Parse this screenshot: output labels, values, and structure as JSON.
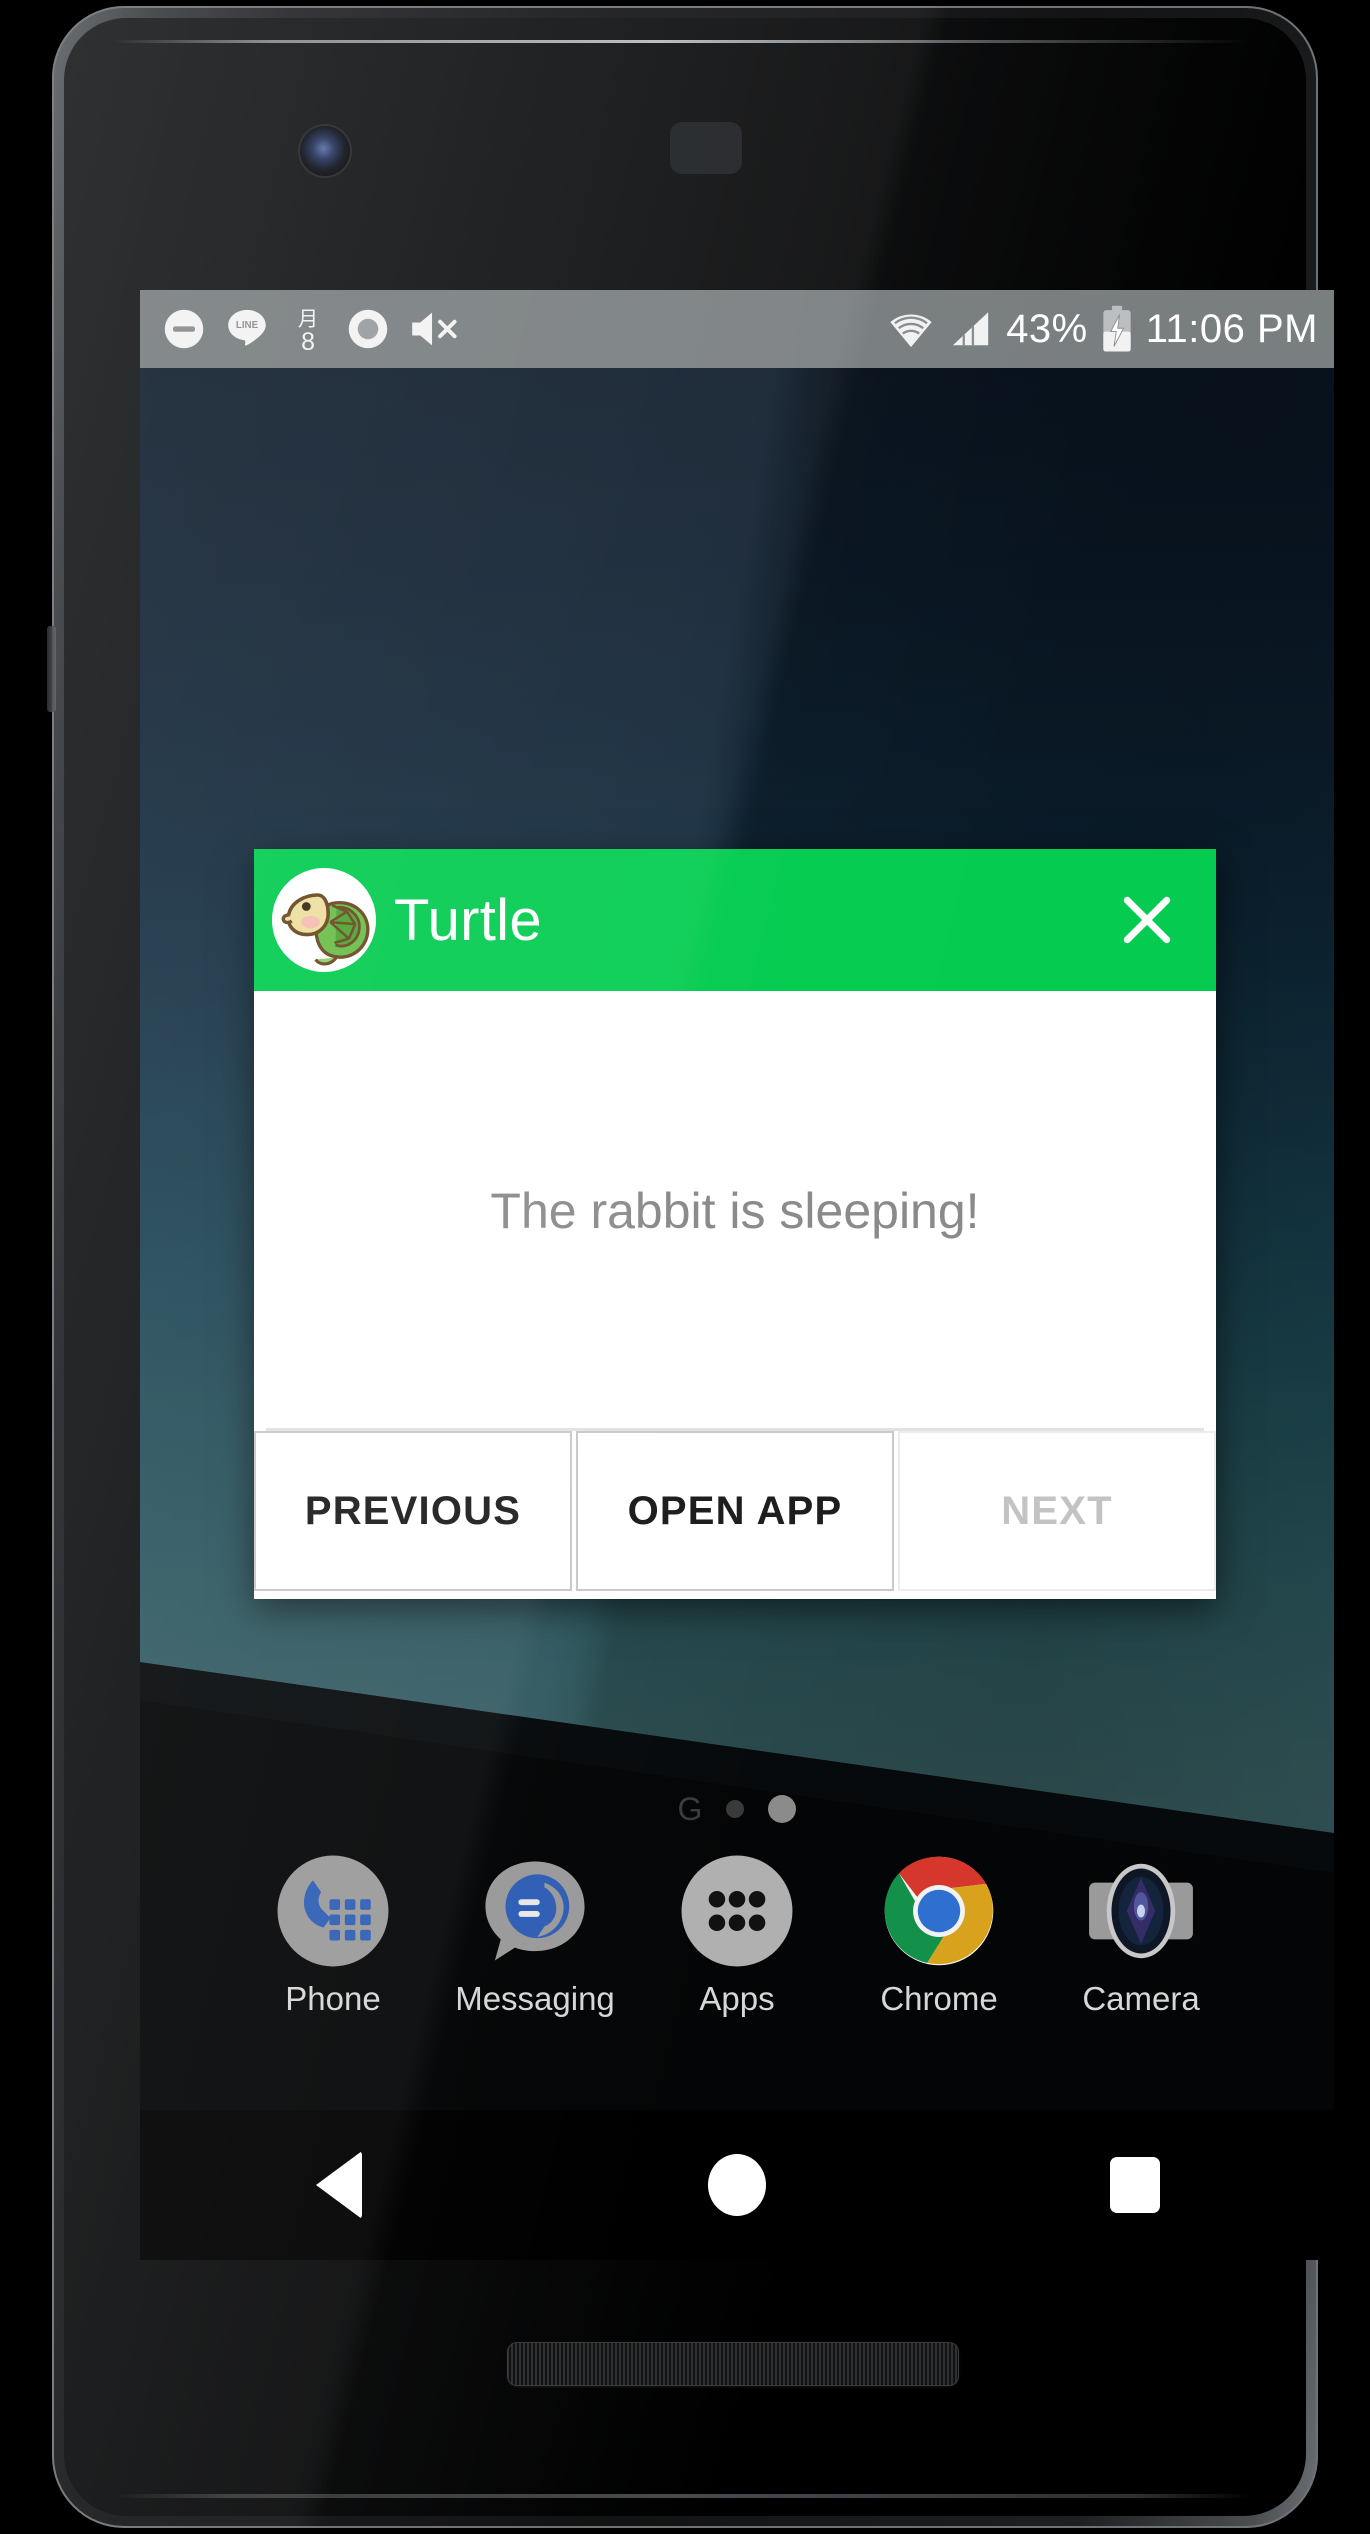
{
  "status_bar": {
    "left_icons": [
      {
        "name": "do-not-disturb-icon",
        "label": "Do not disturb"
      },
      {
        "name": "line-app-icon",
        "label": "LINE"
      },
      {
        "name": "calendar-icon",
        "label": "月8"
      },
      {
        "name": "record-icon",
        "label": "Recording"
      },
      {
        "name": "volume-muted-icon",
        "label": "Muted"
      }
    ],
    "calendar_month_glyph": "月",
    "calendar_day": "8",
    "line_label": "LINE",
    "mute_x": "×",
    "wifi_icon": "wifi-icon",
    "signal_icon": "cellular-signal-icon",
    "battery_percent": "43%",
    "battery_icon": "battery-charging-icon",
    "time": "11:06 PM"
  },
  "dialog": {
    "app_icon": "turtle-avatar-icon",
    "title": "Turtle",
    "close_icon": "close-icon",
    "message": "The rabbit is sleeping!",
    "buttons": [
      {
        "label": "PREVIOUS",
        "state": "enabled"
      },
      {
        "label": "OPEN APP",
        "state": "enabled"
      },
      {
        "label": "NEXT",
        "state": "disabled"
      }
    ],
    "header_color": "#05cc51",
    "message_color": "#8a8a8a",
    "disabled_color": "#c3c3c3"
  },
  "home": {
    "google_glyph": "G",
    "page_indicator": {
      "total": 2,
      "active_index": 1
    },
    "dock": [
      {
        "label": "Phone",
        "icon": "phone-icon"
      },
      {
        "label": "Messaging",
        "icon": "messaging-icon"
      },
      {
        "label": "Apps",
        "icon": "apps-grid-icon"
      },
      {
        "label": "Chrome",
        "icon": "chrome-icon"
      },
      {
        "label": "Camera",
        "icon": "camera-icon"
      }
    ]
  },
  "navigation_bar": {
    "back": "back-icon",
    "home": "home-icon",
    "recents": "recents-icon"
  }
}
